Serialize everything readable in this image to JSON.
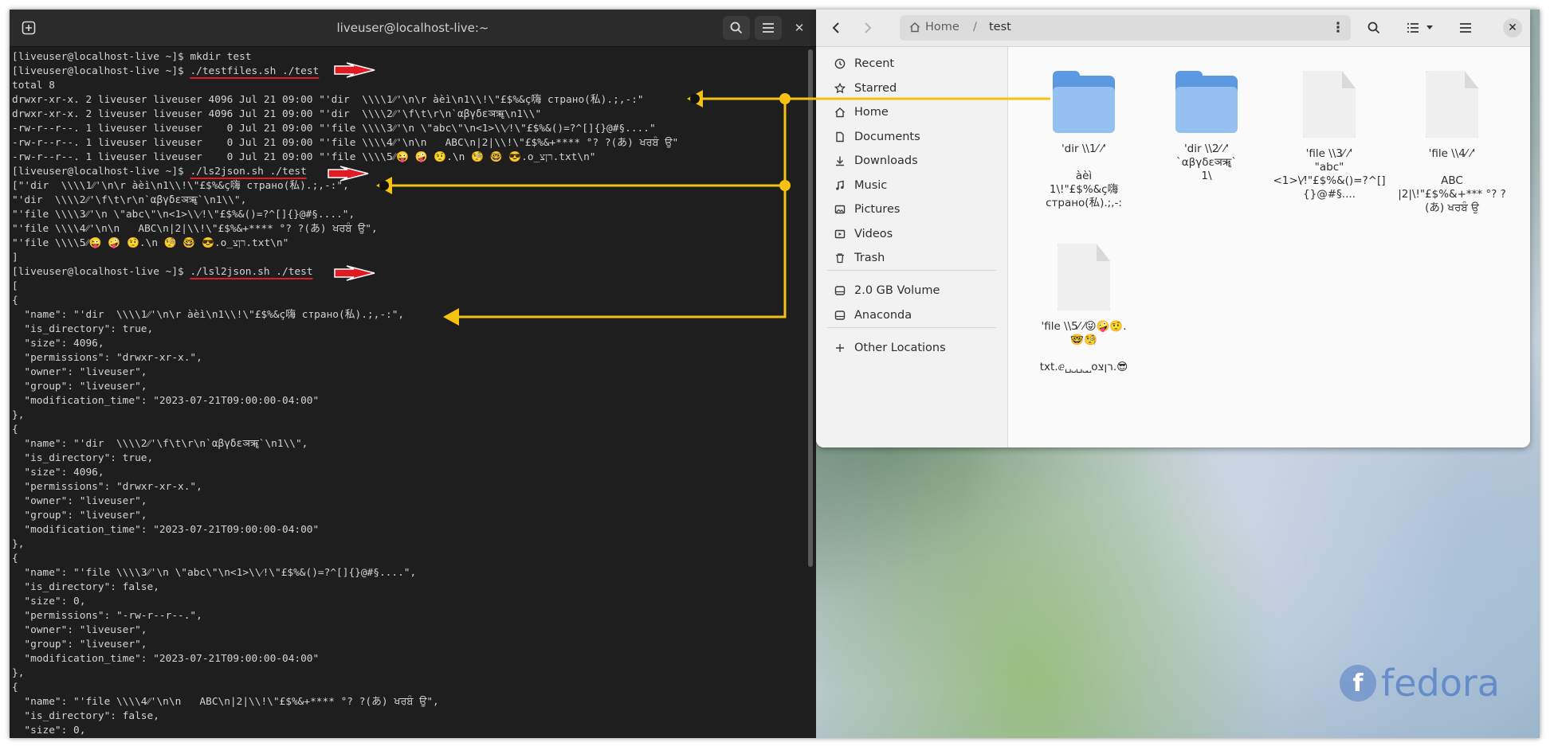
{
  "terminal": {
    "title": "liveuser@localhost-live:~",
    "lines": [
      {
        "prompt": "[liveuser@localhost-live ~]$ ",
        "cmd": "mkdir test",
        "underline": false
      },
      {
        "prompt": "[liveuser@localhost-live ~]$ ",
        "cmd": "./testfiles.sh ./test",
        "underline": true
      },
      {
        "prompt": "",
        "cmd": "total 8",
        "underline": false
      },
      {
        "prompt": "",
        "cmd": "drwxr-xr-x. 2 liveuser liveuser 4096 Jul 21 09:00 \"'dir  \\\\\\\\1⁄⁄'\\n\\r àèì\\n1\\\\!\\\"£$%&ç嗨 страно(私).;,-:\"",
        "underline": false
      },
      {
        "prompt": "",
        "cmd": "drwxr-xr-x. 2 liveuser liveuser 4096 Jul 21 09:00 \"'dir  \\\\\\\\2⁄⁄'\\f\\t\\r\\n`αβγδεञॠ\\n1\\\\\"",
        "underline": false
      },
      {
        "prompt": "",
        "cmd": "-rw-r--r--. 1 liveuser liveuser    0 Jul 21 09:00 \"'file \\\\\\\\3⁄⁄'\\n \\\"abc\\\"\\n<1>\\\\⁄!\\\"£$%&()=?^[]{}@#§....\"",
        "underline": false
      },
      {
        "prompt": "",
        "cmd": "-rw-r--r--. 1 liveuser liveuser    0 Jul 21 09:00 \"'file \\\\\\\\4⁄⁄'\\n\\n   ABC\\n|2|\\\\!\\\"£$%&+**** °? ?(あ) ਖਰਬੰ ਉ\"",
        "underline": false
      },
      {
        "prompt": "",
        "cmd": "-rw-r--r--. 1 liveuser liveuser    0 Jul 21 09:00 \"'file \\\\\\\\5⁄⁄😜 🤪 🤨.\\n 🧐 🤓 😎.o_רןצ.txt\\n\"",
        "underline": false
      },
      {
        "prompt": "[liveuser@localhost-live ~]$ ",
        "cmd": "./ls2json.sh ./test",
        "underline": true
      },
      {
        "prompt": "",
        "cmd": "[\"'dir  \\\\\\\\1⁄⁄'\\n\\r àèì\\n1\\\\!\\\"£$%&ç嗨 страно(私).;,-:\",",
        "underline": false
      },
      {
        "prompt": "",
        "cmd": "\"'dir  \\\\\\\\2⁄⁄'\\f\\t\\r\\n`αβγδεञॠ`\\n1\\\\\",",
        "underline": false
      },
      {
        "prompt": "",
        "cmd": "\"'file \\\\\\\\3⁄⁄'\\n \\\"abc\\\"\\n<1>\\\\⁄!\\\"£$%&()=?^[]{}@#§....\",",
        "underline": false
      },
      {
        "prompt": "",
        "cmd": "\"'file \\\\\\\\4⁄⁄'\\n\\n   ABC\\n|2|\\\\!\\\"£$%&+**** °? ?(あ) ਖਰਬੰ ਉ\",",
        "underline": false
      },
      {
        "prompt": "",
        "cmd": "\"'file \\\\\\\\5⁄⁄😜 🤪 🤨.\\n 🧐 🤓 😎.o_רןצ.txt\\n\"",
        "underline": false
      },
      {
        "prompt": "",
        "cmd": "]",
        "underline": false
      },
      {
        "prompt": "[liveuser@localhost-live ~]$ ",
        "cmd": "./lsl2json.sh ./test",
        "underline": true
      },
      {
        "prompt": "",
        "cmd": "[",
        "underline": false
      },
      {
        "prompt": "",
        "cmd": "{",
        "underline": false
      },
      {
        "prompt": "",
        "cmd": "  \"name\": \"'dir  \\\\\\\\1⁄⁄'\\n\\r àèì\\n1\\\\!\\\"£$%&ç嗨 страно(私).;,-:\",",
        "underline": false
      },
      {
        "prompt": "",
        "cmd": "  \"is_directory\": true,",
        "underline": false
      },
      {
        "prompt": "",
        "cmd": "  \"size\": 4096,",
        "underline": false
      },
      {
        "prompt": "",
        "cmd": "  \"permissions\": \"drwxr-xr-x.\",",
        "underline": false
      },
      {
        "prompt": "",
        "cmd": "  \"owner\": \"liveuser\",",
        "underline": false
      },
      {
        "prompt": "",
        "cmd": "  \"group\": \"liveuser\",",
        "underline": false
      },
      {
        "prompt": "",
        "cmd": "  \"modification_time\": \"2023-07-21T09:00:00-04:00\"",
        "underline": false
      },
      {
        "prompt": "",
        "cmd": "},",
        "underline": false
      },
      {
        "prompt": "",
        "cmd": "{",
        "underline": false
      },
      {
        "prompt": "",
        "cmd": "  \"name\": \"'dir  \\\\\\\\2⁄⁄'\\f\\t\\r\\n`αβγδεञॠ`\\n1\\\\\",",
        "underline": false
      },
      {
        "prompt": "",
        "cmd": "  \"is_directory\": true,",
        "underline": false
      },
      {
        "prompt": "",
        "cmd": "  \"size\": 4096,",
        "underline": false
      },
      {
        "prompt": "",
        "cmd": "  \"permissions\": \"drwxr-xr-x.\",",
        "underline": false
      },
      {
        "prompt": "",
        "cmd": "  \"owner\": \"liveuser\",",
        "underline": false
      },
      {
        "prompt": "",
        "cmd": "  \"group\": \"liveuser\",",
        "underline": false
      },
      {
        "prompt": "",
        "cmd": "  \"modification_time\": \"2023-07-21T09:00:00-04:00\"",
        "underline": false
      },
      {
        "prompt": "",
        "cmd": "},",
        "underline": false
      },
      {
        "prompt": "",
        "cmd": "{",
        "underline": false
      },
      {
        "prompt": "",
        "cmd": "  \"name\": \"'file \\\\\\\\3⁄⁄'\\n \\\"abc\\\"\\n<1>\\\\⁄!\\\"£$%&()=?^[]{}@#§....\",",
        "underline": false
      },
      {
        "prompt": "",
        "cmd": "  \"is_directory\": false,",
        "underline": false
      },
      {
        "prompt": "",
        "cmd": "  \"size\": 0,",
        "underline": false
      },
      {
        "prompt": "",
        "cmd": "  \"permissions\": \"-rw-r--r--.\",",
        "underline": false
      },
      {
        "prompt": "",
        "cmd": "  \"owner\": \"liveuser\",",
        "underline": false
      },
      {
        "prompt": "",
        "cmd": "  \"group\": \"liveuser\",",
        "underline": false
      },
      {
        "prompt": "",
        "cmd": "  \"modification_time\": \"2023-07-21T09:00:00-04:00\"",
        "underline": false
      },
      {
        "prompt": "",
        "cmd": "},",
        "underline": false
      },
      {
        "prompt": "",
        "cmd": "{",
        "underline": false
      },
      {
        "prompt": "",
        "cmd": "  \"name\": \"'file \\\\\\\\4⁄⁄'\\n\\n   ABC\\n|2|\\\\!\\\"£$%&+**** °? ?(あ) ਖਰਬੰ ਉ\",",
        "underline": false
      },
      {
        "prompt": "",
        "cmd": "  \"is_directory\": false,",
        "underline": false
      },
      {
        "prompt": "",
        "cmd": "  \"size\": 0,",
        "underline": false
      }
    ]
  },
  "files": {
    "path_home": "Home",
    "path_sep": "/",
    "path_current": "test",
    "sidebar": [
      {
        "label": "Recent",
        "icon": "clock-icon"
      },
      {
        "label": "Starred",
        "icon": "star-icon"
      },
      {
        "label": "Home",
        "icon": "home-icon"
      },
      {
        "label": "Documents",
        "icon": "document-icon"
      },
      {
        "label": "Downloads",
        "icon": "download-icon"
      },
      {
        "label": "Music",
        "icon": "music-icon"
      },
      {
        "label": "Pictures",
        "icon": "pictures-icon"
      },
      {
        "label": "Videos",
        "icon": "video-icon"
      },
      {
        "label": "Trash",
        "icon": "trash-icon"
      },
      {
        "label": "2.0 GB Volume",
        "icon": "drive-icon"
      },
      {
        "label": "Anaconda",
        "icon": "drive-icon"
      },
      {
        "label": "Other Locations",
        "icon": "plus-icon"
      }
    ],
    "items": [
      {
        "type": "folder",
        "label": "'dir \\\\1⁄ ⁄'\n\nàèì\n1\\!\"£$%&ç嗨\nстрано(私).;,-:"
      },
      {
        "type": "folder",
        "label": "'dir \\\\2⁄ ⁄'\t\n`αβγδεञॠ`\n1\\"
      },
      {
        "type": "file",
        "label": "'file \\\\3⁄ ⁄'\n\"abc\"\n<1>\\⁄!\"£$%&()=?^[]\n{}@#§...."
      },
      {
        "type": "file",
        "label": "'file \\\\4⁄ ⁄'\n\nABC\n|2|\\!\"£$%&+*** °? ?\n(あ) ਖਰਬੰ ਉ"
      },
      {
        "type": "file",
        "label": "'file \\\\5⁄ ⁄😜🤪🤨.\n🤓🧐\n\ntxt.ⅇ␣⎵␣⎵⎵oרןצ.😎"
      }
    ]
  },
  "wallpaper": {
    "brand": "fedora"
  },
  "colors": {
    "arrow_red": "#e01b24",
    "connector_yellow": "#f5c211",
    "folder_blue": "#5b9ae3",
    "terminal_bg": "#1e1e1e"
  }
}
